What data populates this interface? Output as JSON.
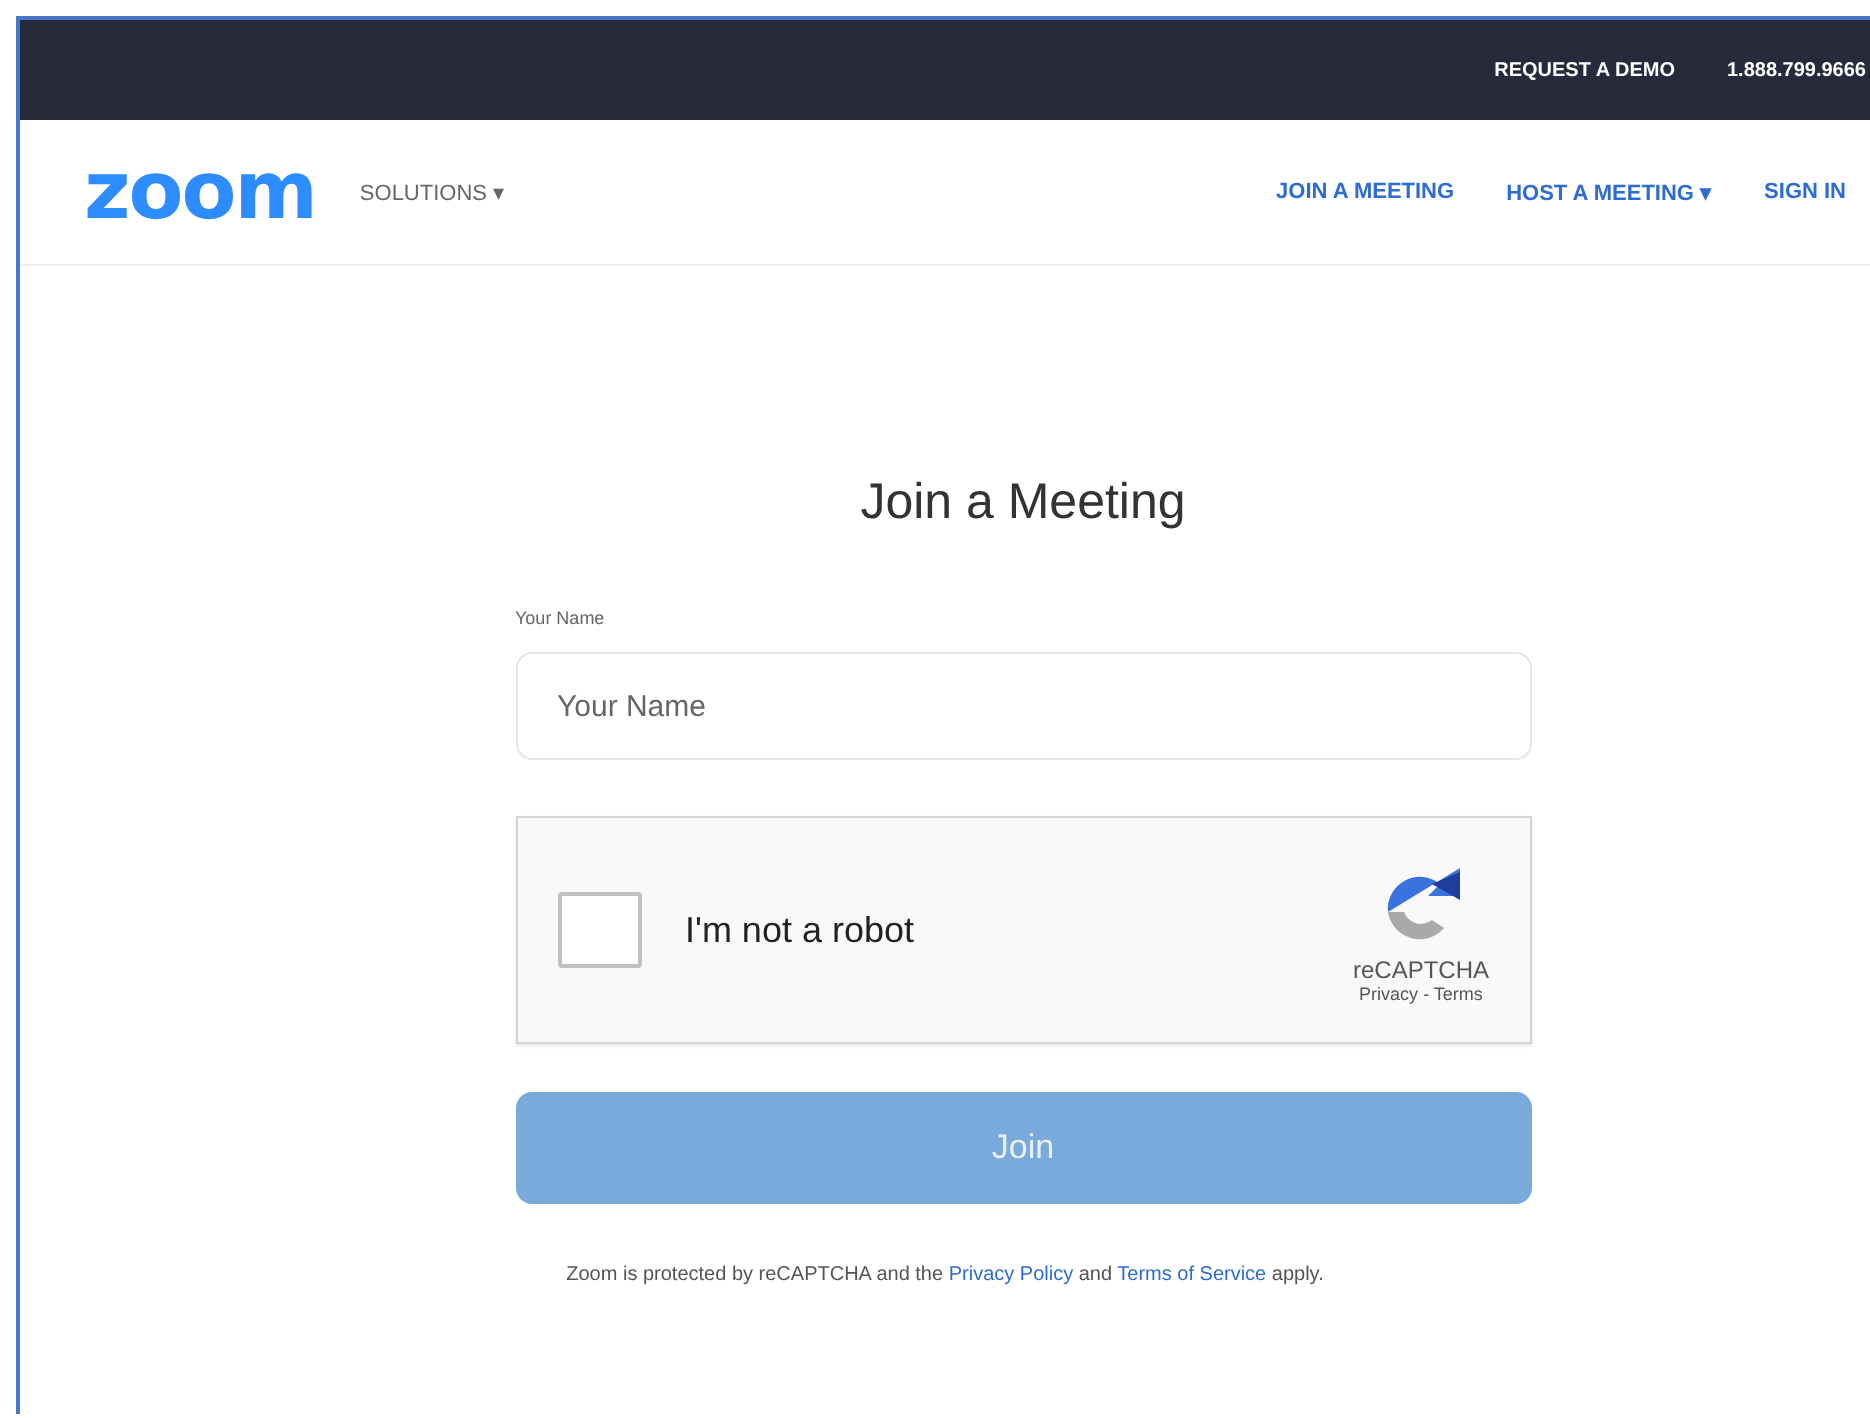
{
  "top_bar": {
    "links": [
      "REQUEST A DEMO",
      "1.888.799.9666"
    ]
  },
  "nav": {
    "logo": "zoom",
    "menu": {
      "label": "SOLUTIONS",
      "caret": "▾"
    },
    "links": [
      {
        "label": "JOIN A MEETING"
      },
      {
        "label": "HOST A MEETING",
        "caret": "▾"
      },
      {
        "label": "SIGN IN"
      }
    ]
  },
  "form": {
    "title": "Join a Meeting",
    "name_label": "Your Name",
    "name_field": {
      "placeholder": "Your Name"
    },
    "captcha": {
      "checked": false,
      "label": "I'm not a robot",
      "brand": "reCAPTCHA",
      "privacy": "Privacy",
      "separator": "-",
      "terms": "Terms"
    },
    "join_button": {
      "label": "Join",
      "disabled": true
    }
  },
  "footer": {
    "parts": [
      {
        "kind": "text",
        "text": "Zoom is protected by reCAPTCHA and the "
      },
      {
        "kind": "link",
        "text": "Privacy Policy"
      },
      {
        "kind": "text",
        "text": " and "
      },
      {
        "kind": "link",
        "text": "Terms of Service"
      },
      {
        "kind": "text",
        "text": " apply."
      }
    ]
  }
}
